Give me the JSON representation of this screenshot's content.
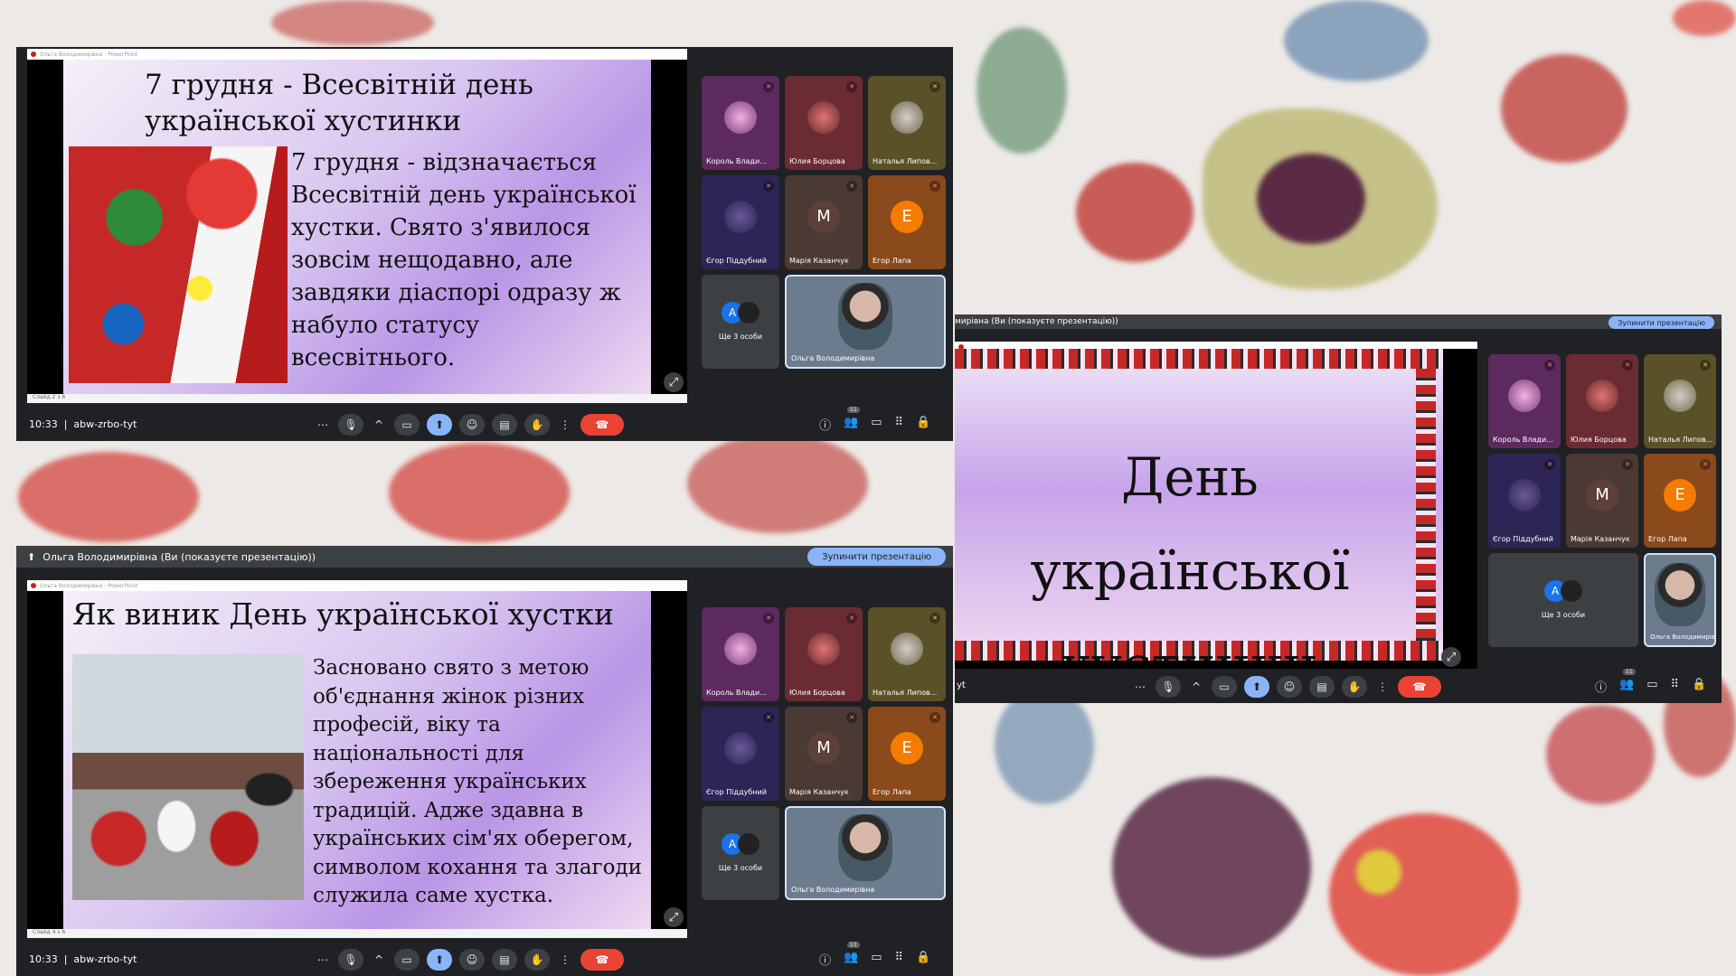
{
  "meeting": {
    "time": "10:33",
    "code": "abw-zrbo-tyt",
    "participant_count": "11",
    "presenting_bar": "Ольга Володимирівна (Ви (показуєте презентацію))",
    "presenting_bar_short": "мирівна (Ви (показуєте презентацію))",
    "stop_button": "Зупинити презентацію",
    "more_people": "Ще 3 особи",
    "window_title": "Ольга Володимирівна - PowerPoint"
  },
  "participants": [
    {
      "name": "Король Влади...",
      "muted": true
    },
    {
      "name": "Юлия Борцова",
      "muted": true
    },
    {
      "name": "Наталья Липов...",
      "muted": true
    },
    {
      "name": "Єгор Піддубний",
      "muted": true
    },
    {
      "name": "Марія Казанчук",
      "muted": true,
      "initial": "M"
    },
    {
      "name": "Егор Лапа",
      "muted": true,
      "initial": "E"
    },
    {
      "name": "Ольга Володимирівна",
      "muted": false
    }
  ],
  "more_avatars": [
    "A",
    ""
  ],
  "slides": {
    "s1": {
      "title": "7 грудня - Всесвітній день української хустинки",
      "body": "7 грудня - відзначається Всесвітній день української хустки. Свято з'явилося зовсім нещодавно, але завдяки діаспорі одразу ж набуло статусу всесвітнього.",
      "status": "Слайд 2 з 6"
    },
    "s2": {
      "title": "День української хустинки"
    },
    "s3": {
      "title": "Як виник День української хустки",
      "body": "Засновано свято з метою об'єднання жінок різних професій, віку та національності для збереження українських традицій. Адже здавна в українських сім'ях оберегом, символом кохання та злагоди служила саме хустка.",
      "status": "Слайд 4 з 6"
    }
  },
  "icons": [
    "more-icon",
    "mic-icon",
    "chevron-up-icon",
    "camera-icon",
    "present-icon",
    "emoji-icon",
    "captions-icon",
    "hand-icon",
    "more-vert-icon",
    "end-call-icon",
    "info-icon",
    "people-icon",
    "chat-icon",
    "apps-icon",
    "lock-icon"
  ],
  "colors": {
    "end_call": "#ea4335",
    "present_active": "#8ab4f8",
    "bar": "#202124"
  }
}
